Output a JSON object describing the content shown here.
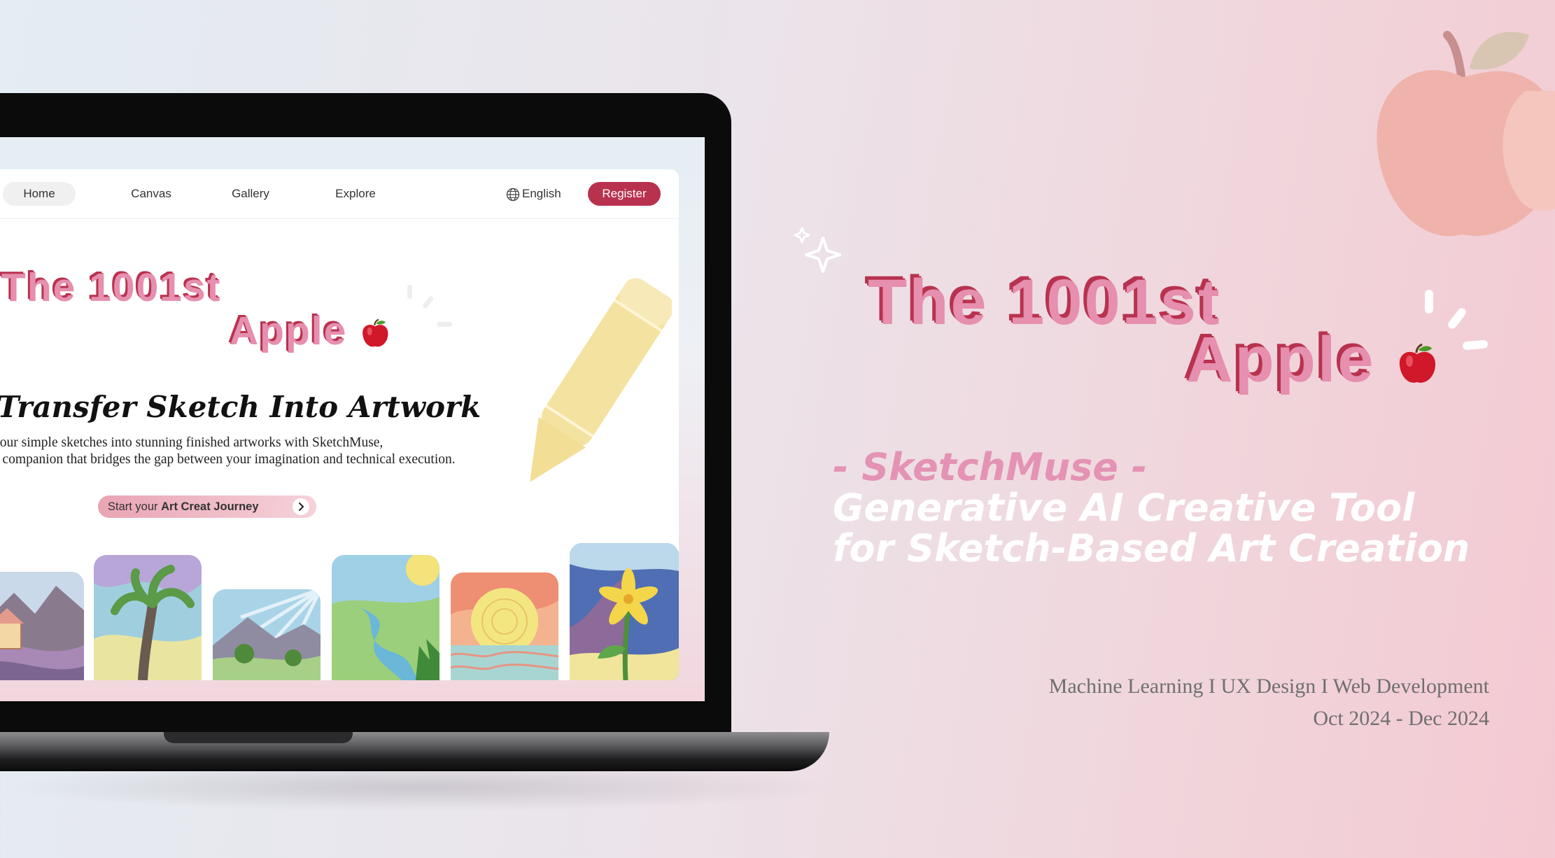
{
  "poster": {
    "title_line1": "The 1001st",
    "title_line2": "Apple",
    "subtitle_line1": "- SketchMuse -",
    "subtitle_line2": "Generative AI Creative Tool",
    "subtitle_line3": "for Sketch-Based Art Creation",
    "tags": "Machine Learning I UX Design I Web Development",
    "dates": "Oct 2024 - Dec 2024"
  },
  "site": {
    "nav": {
      "items": [
        {
          "label": "Home"
        },
        {
          "label": "Canvas"
        },
        {
          "label": "Gallery"
        },
        {
          "label": "Explore"
        }
      ],
      "language": "English",
      "register": "Register"
    },
    "hero": {
      "title_line1": "The 1001st",
      "title_line2": "Apple",
      "headline": "Transfer Sketch Into Artwork",
      "description_line1": "your simple sketches into stunning finished artworks with SketchMuse,",
      "description_line2": "e companion that bridges the gap between your imagination and technical execution.",
      "cta_prefix": "Start your ",
      "cta_bold": "Art Creat Journey"
    },
    "gallery": [
      "house-hills-art",
      "palm-tree-art",
      "mountain-sunrays-art",
      "river-landscape-art",
      "sun-sea-art",
      "yellow-flower-art"
    ]
  },
  "colors": {
    "accent": "#b8324f",
    "pink": "#e68fae",
    "pencil": "#f4e3a0"
  },
  "icons": [
    "apple-icon",
    "sparkle-icon",
    "globe-icon",
    "chevron-right-icon",
    "pencil-illustration"
  ]
}
